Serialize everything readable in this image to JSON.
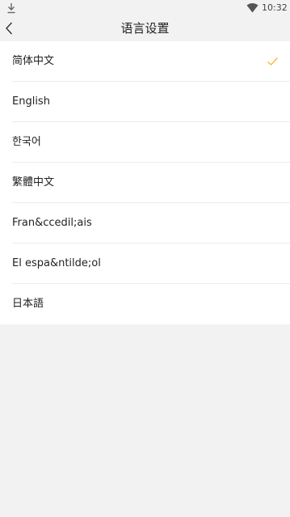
{
  "status_bar": {
    "time": "10:32",
    "icons": [
      "download-icon",
      "wifi-icon"
    ]
  },
  "header": {
    "title": "语言设置",
    "back_icon": "chevron-left-icon"
  },
  "languages": [
    {
      "label": "简体中文",
      "selected": true
    },
    {
      "label": "English",
      "selected": false
    },
    {
      "label": "한국어",
      "selected": false
    },
    {
      "label": "繁體中文",
      "selected": false
    },
    {
      "label": "Fran&ccedil;ais",
      "selected": false
    },
    {
      "label": "El espa&ntilde;ol",
      "selected": false
    },
    {
      "label": "日本語",
      "selected": false
    }
  ],
  "colors": {
    "accent": "#f5b82e",
    "background": "#f2f2f2",
    "list_background": "#ffffff"
  }
}
